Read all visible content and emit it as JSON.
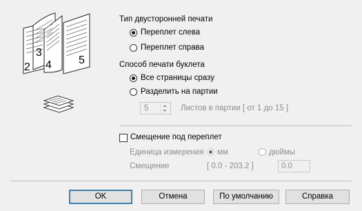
{
  "duplex_type": {
    "heading": "Тип двусторонней печати",
    "options": [
      "Переплет слева",
      "Переплет справа"
    ],
    "selected": 0
  },
  "booklet": {
    "heading": "Способ печати буклета",
    "options": [
      "Все страницы сразу",
      "Разделить на партии"
    ],
    "selected": 0,
    "batch_value": "5",
    "batch_label": "Листов в партии [ от 1 до 15 ]"
  },
  "binding_offset": {
    "checkbox_label": "Смещение под переплет",
    "checked": false,
    "unit_label": "Единица измерения",
    "unit_options": [
      "мм",
      "дюймы"
    ],
    "offset_label": "Смещение",
    "range": "[ 0.0 - 203.2 ]",
    "value": "0.0"
  },
  "illustration": {
    "pages": [
      "3",
      "2",
      "4",
      "5"
    ]
  },
  "buttons": {
    "ok": "OK",
    "cancel": "Отмена",
    "default": "По умолчанию",
    "help": "Справка"
  }
}
